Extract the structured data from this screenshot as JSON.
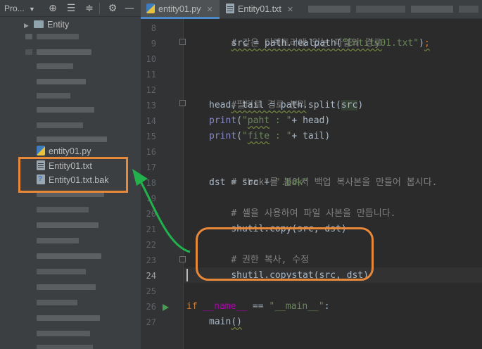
{
  "project_panel": {
    "title": "Pro...",
    "toolbar_icons": [
      "target-icon",
      "expand-icon",
      "collapse-icon",
      "gear-icon",
      "hide-icon"
    ],
    "tree": {
      "folder": "Entity",
      "files": [
        {
          "name": "entity01.py",
          "icon": "python-file-icon"
        },
        {
          "name": "Entity01.txt",
          "icon": "text-file-icon"
        },
        {
          "name": "Entity01.txt.bak",
          "icon": "unknown-file-icon"
        }
      ]
    }
  },
  "tabs": [
    {
      "label": "entity01.py",
      "icon": "python-file-icon",
      "active": true
    },
    {
      "label": "Entity01.txt",
      "icon": "text-file-icon",
      "active": false
    }
  ],
  "editor": {
    "line_numbers": [
      "8",
      "9",
      "10",
      "11",
      "12",
      "13",
      "14",
      "15",
      "16",
      "17",
      "18",
      "19",
      "20",
      "21",
      "22",
      "23",
      "24",
      "25",
      "26",
      "27"
    ],
    "current_line": "24",
    "code": {
      "l8": "# 같은 디렉토리에 있는 파일의 경로",
      "l9": [
        "src = path.realpath(",
        "\"Entity01.txt\"",
        ")",
        ";"
      ],
      "l12": "#필터로 경로 분리",
      "l13": [
        "head, tail = path.split(",
        "src",
        ")"
      ],
      "l14": [
        "print",
        "(",
        "\"",
        "paht",
        " : \"",
        "+ head)"
      ],
      "l15": [
        "print",
        "(",
        "\"",
        "fite",
        " : \"",
        "+ tail)"
      ],
      "l17": "# \"bak\"를 붙여서 백업 복사본을 만들어 봅시다.",
      "l18": [
        "dst = src + ",
        "\".bak\""
      ],
      "l19": "# 셸을 사용하여 파일 사본을 만듭니다.",
      "l20": "shutil.copy(src, dst)",
      "l22": "# 권한 복사, 수정",
      "l23": "shutil.copystat(src, dst)",
      "l26": [
        "if ",
        "__name__",
        " == ",
        "\"__main__\"",
        ":"
      ],
      "l27": [
        "main",
        "()"
      ]
    }
  },
  "colors": {
    "annotation_box": "#e8893a",
    "annotation_arrow": "#22b14c",
    "comment": "#808080",
    "string": "#6a8759",
    "keyword": "#cc7832"
  }
}
